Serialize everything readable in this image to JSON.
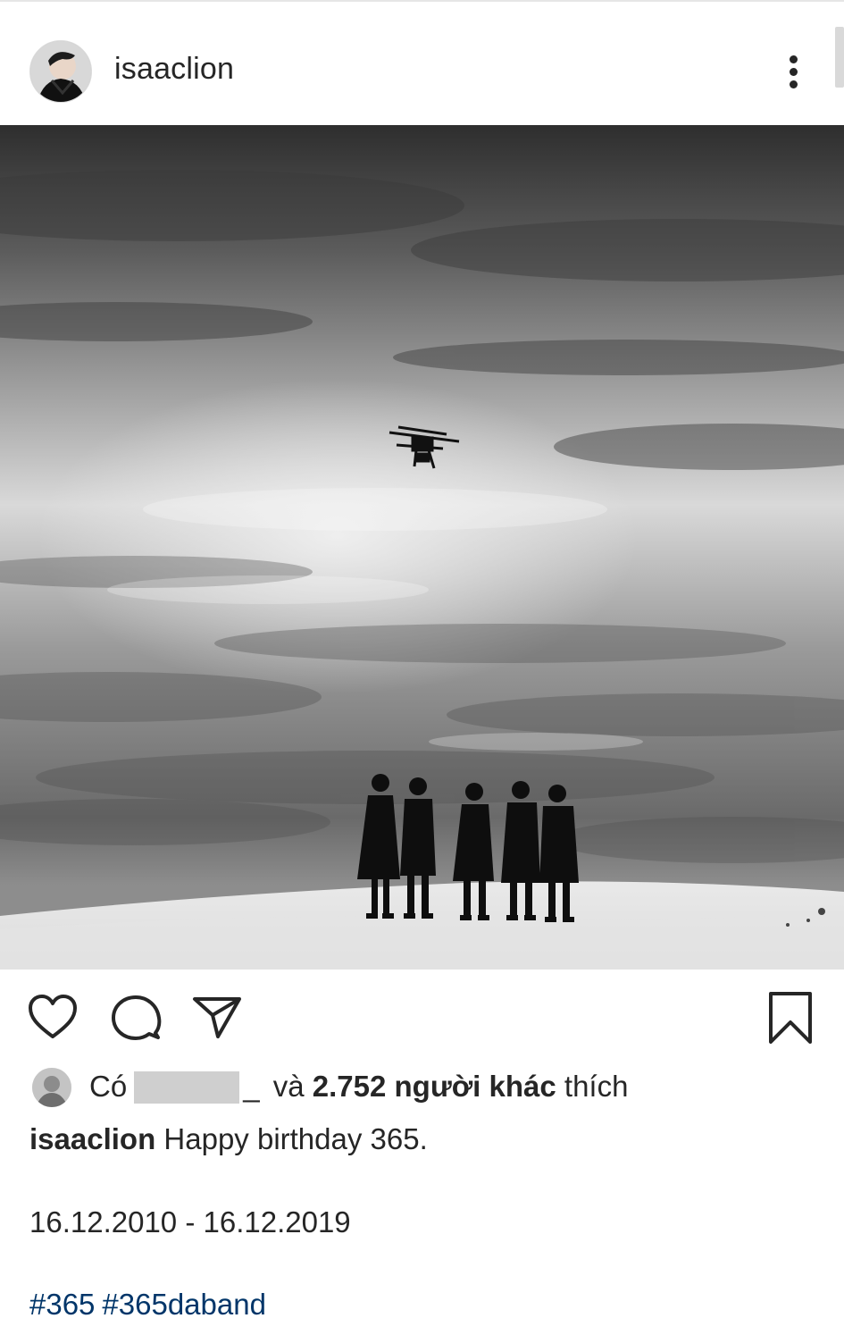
{
  "post": {
    "username": "isaaclion",
    "avatar_alt": "avatar",
    "photo_alt": "Black and white photo of five men in dark coats standing on white sand dunes under a cloudy sky with a drone hovering above"
  },
  "icons": {
    "more": "more-options-icon",
    "like": "heart-icon",
    "comment": "comment-bubble-icon",
    "share": "paper-plane-icon",
    "save": "bookmark-icon"
  },
  "likes": {
    "prefix": "Có",
    "underscore": "_",
    "connector": "và",
    "count_text": "2.752 người khác",
    "suffix": "thích"
  },
  "caption": {
    "username": "isaaclion",
    "text": "Happy birthday 365."
  },
  "dates": "16.12.2010 - 16.12.2019",
  "hashtags": [
    "#365",
    "#365daband"
  ],
  "colors": {
    "text": "#262626",
    "hashtag": "#003569",
    "redaction": "#cfcfcf"
  }
}
